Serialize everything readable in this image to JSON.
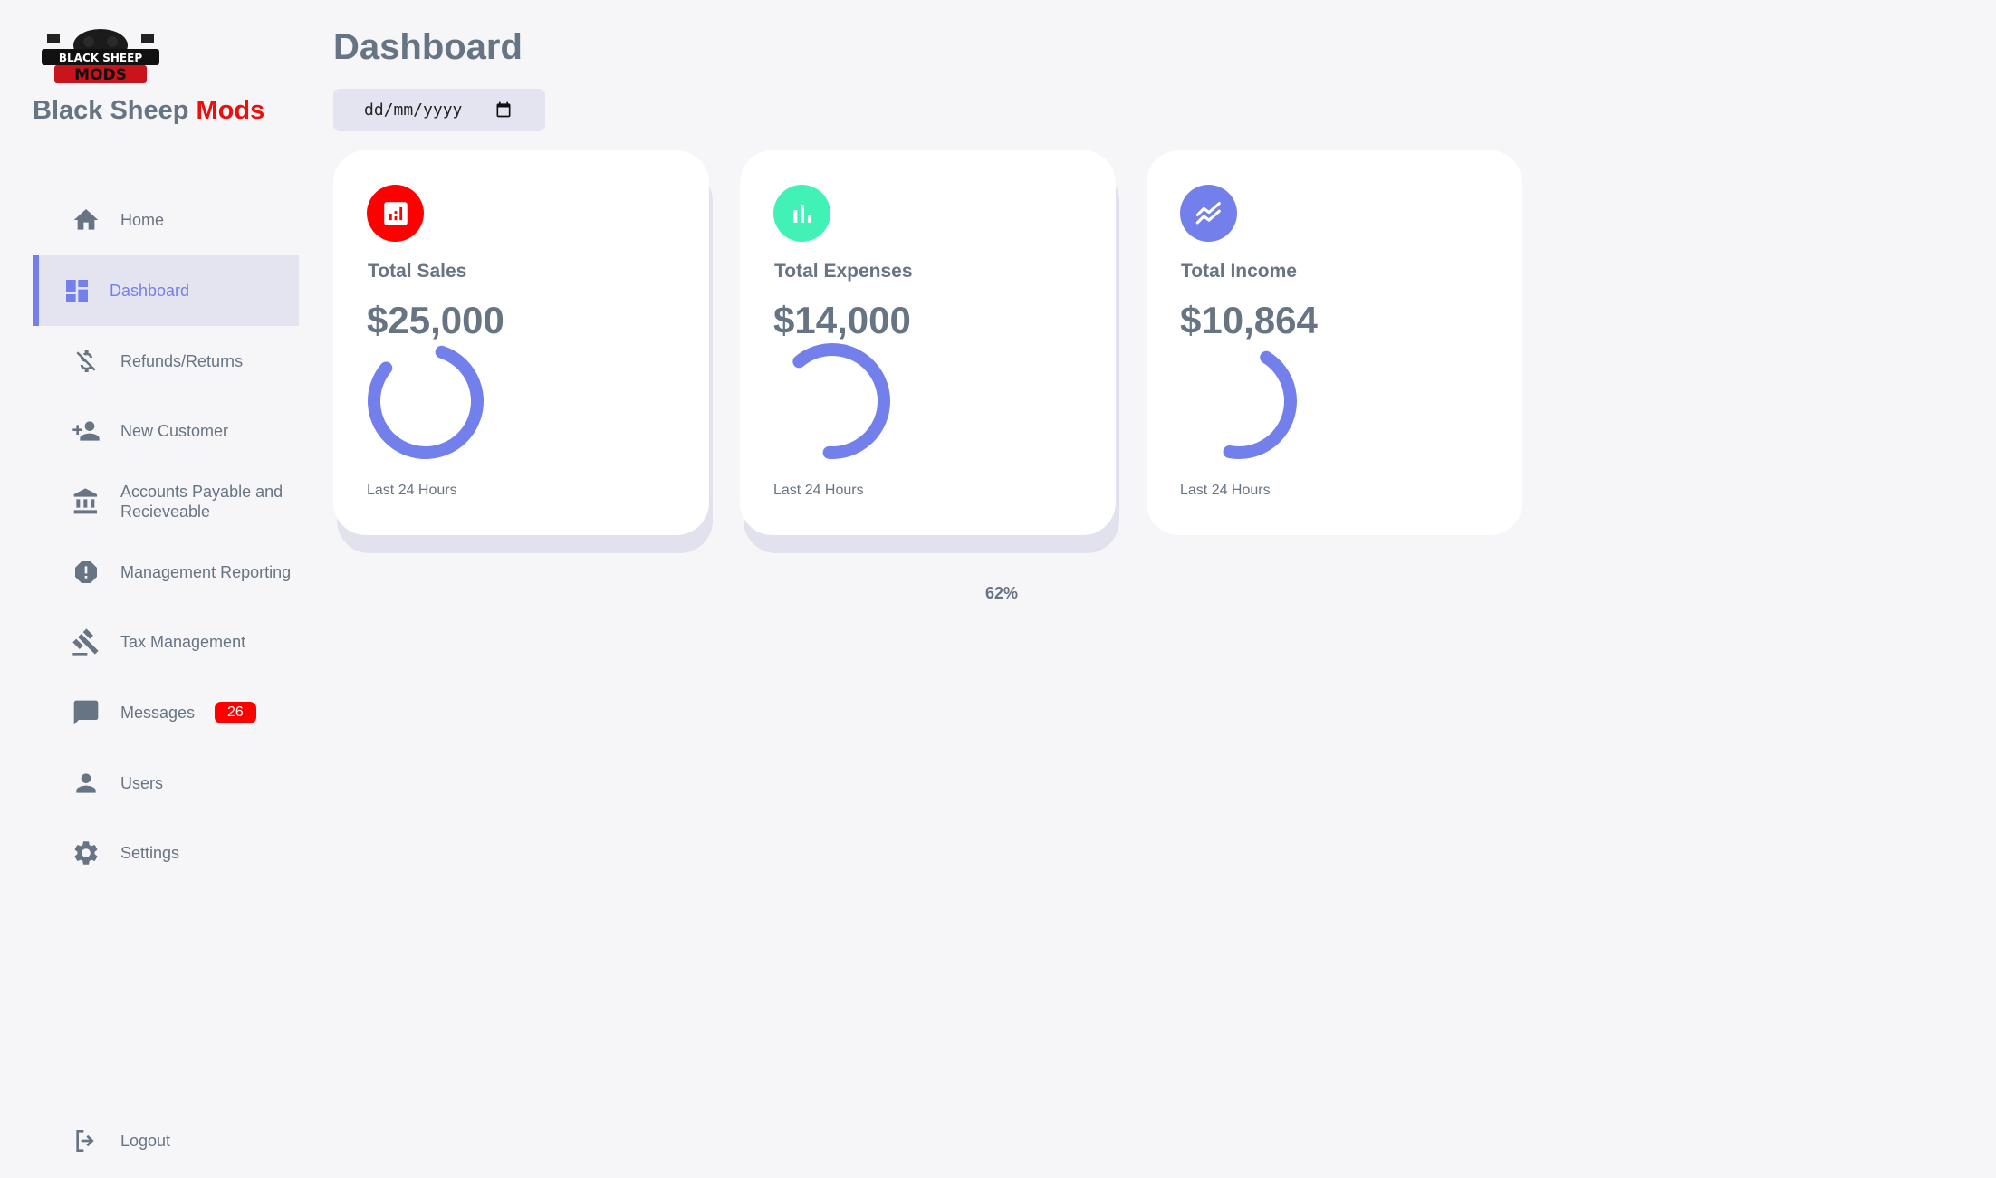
{
  "brand": {
    "name_main": "Black Sheep",
    "name_accent": "Mods",
    "accent_color": "#e8110f"
  },
  "nav": [
    {
      "label": "Home",
      "icon": "home-icon"
    },
    {
      "label": "Dashboard",
      "icon": "dashboard-icon",
      "active": true
    },
    {
      "label": "Refunds/Returns",
      "icon": "money-off-icon"
    },
    {
      "label": "New Customer",
      "icon": "person-add-icon"
    },
    {
      "label": "Accounts Payable and Recieveable",
      "icon": "bank-icon"
    },
    {
      "label": "Management Reporting",
      "icon": "report-icon"
    },
    {
      "label": "Tax Management",
      "icon": "gavel-icon"
    },
    {
      "label": "Messages",
      "icon": "chat-icon",
      "badge": "26"
    },
    {
      "label": "Users",
      "icon": "person-icon"
    },
    {
      "label": "Settings",
      "icon": "settings-icon"
    }
  ],
  "logout": {
    "label": "Logout",
    "icon": "logout-icon"
  },
  "main": {
    "title": "Dashboard",
    "date_placeholder": "dd/mm/yyyy"
  },
  "cards": [
    {
      "label": "Total Sales",
      "value": "$25,000",
      "footer": "Last 24 Hours",
      "icon": "analytics-icon",
      "icon_color": "#ff0000",
      "progress": 0.81
    },
    {
      "label": "Total Expenses",
      "value": "$14,000",
      "footer": "Last 24 Hours",
      "icon": "bar-chart-icon",
      "icon_color": "#41f1b6",
      "progress": 0.62
    },
    {
      "label": "Total Income",
      "value": "$10,864",
      "footer": "Last 24 Hours",
      "icon": "stocks-icon",
      "icon_color": "#7380ec",
      "progress": 0.44
    }
  ],
  "percent_text": "62%",
  "ring_color": "#7380ec"
}
